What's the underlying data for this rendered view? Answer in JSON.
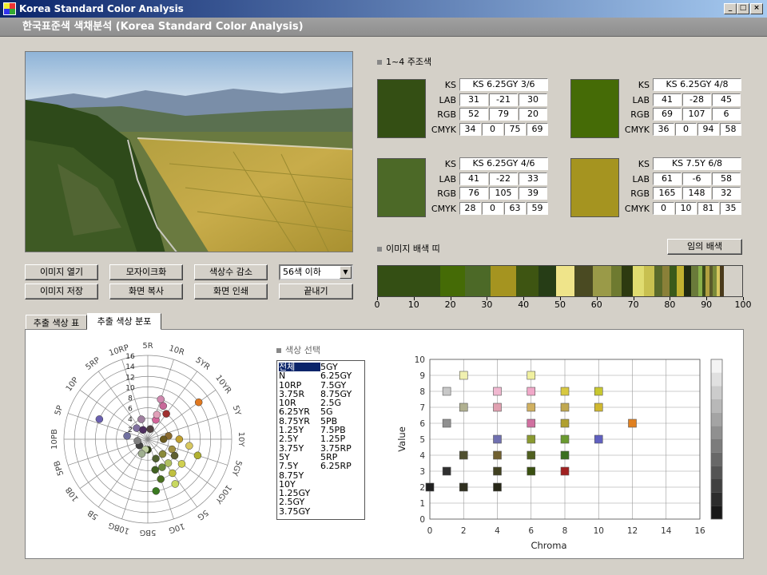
{
  "window": {
    "title": "Korea Standard Color Analysis",
    "min": "_",
    "max": "□",
    "close": "×"
  },
  "banner": "한국표준색 색채분석 (Korea Standard Color Analysis)",
  "buttons": {
    "open": "이미지 열기",
    "mosaic": "모자이크화",
    "reduce": "색상수 감소",
    "save": "이미지 저장",
    "copy": "화면 복사",
    "print": "화면 인쇄",
    "exit": "끝내기",
    "random": "임의 배색"
  },
  "select": {
    "value": "56색 이하",
    "arrow": "▼"
  },
  "main_colors": {
    "heading": "1~4 주조색",
    "labels": [
      "KS",
      "LAB",
      "RGB",
      "CMYK"
    ],
    "items": [
      {
        "ks": "KS 6.25GY 3/6",
        "lab": [
          "31",
          "-21",
          "30"
        ],
        "rgb": [
          "52",
          "79",
          "20"
        ],
        "cmyk": [
          "34",
          "0",
          "75",
          "69"
        ],
        "color": "#344f14"
      },
      {
        "ks": "KS 6.25GY 4/8",
        "lab": [
          "41",
          "-28",
          "45"
        ],
        "rgb": [
          "69",
          "107",
          "6"
        ],
        "cmyk": [
          "36",
          "0",
          "94",
          "58"
        ],
        "color": "#456b06"
      },
      {
        "ks": "KS 6.25GY 4/6",
        "lab": [
          "41",
          "-22",
          "33"
        ],
        "rgb": [
          "76",
          "105",
          "39"
        ],
        "cmyk": [
          "28",
          "0",
          "63",
          "59"
        ],
        "color": "#4c6927"
      },
      {
        "ks": "KS 7.5Y 6/8",
        "lab": [
          "61",
          "-6",
          "58"
        ],
        "rgb": [
          "165",
          "148",
          "32"
        ],
        "cmyk": [
          "0",
          "10",
          "81",
          "35"
        ],
        "color": "#a59420"
      }
    ]
  },
  "palette": {
    "heading": "이미지 배색 띠",
    "ticks": [
      "0",
      "10",
      "20",
      "30",
      "40",
      "50",
      "60",
      "70",
      "80",
      "90",
      "100"
    ],
    "segments": [
      {
        "w": 17,
        "c": "#344f14"
      },
      {
        "w": 7,
        "c": "#456b06"
      },
      {
        "w": 7,
        "c": "#4c6927"
      },
      {
        "w": 7,
        "c": "#a59420"
      },
      {
        "w": 6,
        "c": "#3e5512"
      },
      {
        "w": 5,
        "c": "#263d16"
      },
      {
        "w": 5,
        "c": "#efe48a"
      },
      {
        "w": 5,
        "c": "#4a4a22"
      },
      {
        "w": 5,
        "c": "#9a9a48"
      },
      {
        "w": 3,
        "c": "#6e7a30"
      },
      {
        "w": 3,
        "c": "#2d3a10"
      },
      {
        "w": 3,
        "c": "#e0dc70"
      },
      {
        "w": 3,
        "c": "#c8c050"
      },
      {
        "w": 2,
        "c": "#5a6a2a"
      },
      {
        "w": 2,
        "c": "#8a8038"
      },
      {
        "w": 2,
        "c": "#3a5a1a"
      },
      {
        "w": 2,
        "c": "#c0b030"
      },
      {
        "w": 2,
        "c": "#202a10"
      },
      {
        "w": 2,
        "c": "#6a7a3a"
      },
      {
        "w": 1,
        "c": "#8ab04a"
      },
      {
        "w": 1,
        "c": "#3a4a1a"
      },
      {
        "w": 1,
        "c": "#b0a040"
      },
      {
        "w": 1,
        "c": "#5a5a2a"
      },
      {
        "w": 1,
        "c": "#7a8a3a"
      },
      {
        "w": 1,
        "c": "#d8c860"
      },
      {
        "w": 1,
        "c": "#4a3a1a"
      }
    ]
  },
  "tabs": [
    "추출 색상 표",
    "추출 색상 분포"
  ],
  "color_select": {
    "heading": "색상 선택",
    "col1": [
      "전체",
      "N",
      "10RP",
      "3.75R",
      "10R",
      "6.25YR",
      "8.75YR",
      "1.25Y",
      "2.5Y",
      "3.75Y",
      "5Y",
      "7.5Y",
      "8.75Y",
      "10Y",
      "1.25GY",
      "2.5GY",
      "3.75GY"
    ],
    "col2": [
      "5GY",
      "6.25GY",
      "7.5GY",
      "8.75GY",
      "2.5G",
      "5G",
      "5PB",
      "7.5PB",
      "1.25P",
      "3.75RP",
      "5RP",
      "6.25RP"
    ]
  },
  "polar": {
    "hue_labels": [
      "5R",
      "10R",
      "5YR",
      "10YR",
      "5Y",
      "10Y",
      "5GY",
      "10GY",
      "5G",
      "10G",
      "5BG",
      "10BG",
      "5B",
      "10B",
      "5PB",
      "10PB",
      "5P",
      "10P",
      "5RP",
      "10RP"
    ],
    "ring_labels": [
      "2",
      "4",
      "6",
      "8",
      "10",
      "12",
      "14",
      "16"
    ],
    "points": [
      {
        "hue": 5,
        "chroma": 4,
        "color": "#d4649a"
      },
      {
        "hue": 4,
        "chroma": 8,
        "color": "#d08ab0"
      },
      {
        "hue": 5.5,
        "chroma": 7,
        "color": "#c86a9a"
      },
      {
        "hue": 3,
        "chroma": 2,
        "color": "#504040"
      },
      {
        "hue": 4.5,
        "chroma": 5,
        "color": "#e0a0b8"
      },
      {
        "hue": 8,
        "chroma": 6,
        "color": "#a03030"
      },
      {
        "hue": 12,
        "chroma": 12,
        "color": "#e07820"
      },
      {
        "hue": 20,
        "chroma": 6,
        "color": "#c0a030"
      },
      {
        "hue": 22,
        "chroma": 8,
        "color": "#d8c860"
      },
      {
        "hue": 24,
        "chroma": 10,
        "color": "#b0b030"
      },
      {
        "hue": 18,
        "chroma": 4,
        "color": "#8a6a30"
      },
      {
        "hue": 20,
        "chroma": 3,
        "color": "#6a5a20"
      },
      {
        "hue": 25,
        "chroma": 5,
        "color": "#a09040"
      },
      {
        "hue": 27,
        "chroma": 6,
        "color": "#606030"
      },
      {
        "hue": 28,
        "chroma": 8,
        "color": "#d0d050"
      },
      {
        "hue": 30,
        "chroma": 4,
        "color": "#8a8a3a"
      },
      {
        "hue": 31,
        "chroma": 6,
        "color": "#b0c060"
      },
      {
        "hue": 32,
        "chroma": 8,
        "color": "#c0c040"
      },
      {
        "hue": 33,
        "chroma": 10,
        "color": "#c8d860"
      },
      {
        "hue": 34,
        "chroma": 6,
        "color": "#6a8a3a"
      },
      {
        "hue": 35,
        "chroma": 4,
        "color": "#506030"
      },
      {
        "hue": 36,
        "chroma": 8,
        "color": "#4a7020"
      },
      {
        "hue": 37,
        "chroma": 6,
        "color": "#406020"
      },
      {
        "hue": 38,
        "chroma": 10,
        "color": "#3a7a20"
      },
      {
        "hue": 40,
        "chroma": 2,
        "color": "#2a3a10"
      },
      {
        "hue": 43,
        "chroma": 2,
        "color": "#c0d0a0"
      },
      {
        "hue": 45,
        "chroma": 3,
        "color": "#a0b090"
      },
      {
        "hue": 52,
        "chroma": 2,
        "color": "#404040"
      },
      {
        "hue": 58,
        "chroma": 2,
        "color": "#808080"
      },
      {
        "hue": 62,
        "chroma": 4,
        "color": "#7070a0"
      },
      {
        "hue": 65,
        "chroma": 10,
        "color": "#6a60b0"
      },
      {
        "hue": 70,
        "chroma": 3,
        "color": "#8070a0"
      },
      {
        "hue": 74,
        "chroma": 2,
        "color": "#503060"
      },
      {
        "hue": 76,
        "chroma": 4,
        "color": "#a080a0"
      }
    ]
  },
  "chart_data": {
    "type": "scatter",
    "xlabel": "Chroma",
    "ylabel": "Value",
    "xlim": [
      0,
      16
    ],
    "ylim": [
      0,
      10
    ],
    "xticks": [
      "0",
      "2",
      "4",
      "6",
      "8",
      "10",
      "12",
      "14",
      "16"
    ],
    "yticks": [
      "0",
      "1",
      "2",
      "3",
      "4",
      "5",
      "6",
      "7",
      "8",
      "9",
      "10"
    ],
    "points": [
      {
        "x": 2,
        "y": 9,
        "color": "#f0f0b0"
      },
      {
        "x": 6,
        "y": 9,
        "color": "#f0f0a0"
      },
      {
        "x": 1,
        "y": 8,
        "color": "#c8c8c8"
      },
      {
        "x": 4,
        "y": 8,
        "color": "#f0b8d0"
      },
      {
        "x": 6,
        "y": 8,
        "color": "#f0a8c8"
      },
      {
        "x": 8,
        "y": 8,
        "color": "#d8c840"
      },
      {
        "x": 10,
        "y": 8,
        "color": "#c8c830"
      },
      {
        "x": 2,
        "y": 7,
        "color": "#b0b090"
      },
      {
        "x": 4,
        "y": 7,
        "color": "#e0a0b0"
      },
      {
        "x": 6,
        "y": 7,
        "color": "#d0b060"
      },
      {
        "x": 8,
        "y": 7,
        "color": "#c0a850"
      },
      {
        "x": 10,
        "y": 7,
        "color": "#d0b830"
      },
      {
        "x": 1,
        "y": 6,
        "color": "#909090"
      },
      {
        "x": 6,
        "y": 6,
        "color": "#d070a0"
      },
      {
        "x": 8,
        "y": 6,
        "color": "#b0a030"
      },
      {
        "x": 12,
        "y": 6,
        "color": "#e08020"
      },
      {
        "x": 4,
        "y": 5,
        "color": "#7070b0"
      },
      {
        "x": 6,
        "y": 5,
        "color": "#8a9a30"
      },
      {
        "x": 8,
        "y": 5,
        "color": "#6a9a30"
      },
      {
        "x": 10,
        "y": 5,
        "color": "#6060c0"
      },
      {
        "x": 2,
        "y": 4,
        "color": "#505030"
      },
      {
        "x": 4,
        "y": 4,
        "color": "#706030"
      },
      {
        "x": 6,
        "y": 4,
        "color": "#506020"
      },
      {
        "x": 8,
        "y": 4,
        "color": "#3a7020"
      },
      {
        "x": 1,
        "y": 3,
        "color": "#303030"
      },
      {
        "x": 4,
        "y": 3,
        "color": "#404020"
      },
      {
        "x": 6,
        "y": 3,
        "color": "#3a5010"
      },
      {
        "x": 8,
        "y": 3,
        "color": "#a02020"
      },
      {
        "x": 0,
        "y": 2,
        "color": "#202020"
      },
      {
        "x": 2,
        "y": 2,
        "color": "#303020"
      },
      {
        "x": 4,
        "y": 2,
        "color": "#282818"
      }
    ],
    "gray_scale": [
      "#f4f4f4",
      "#e0e0e0",
      "#cccccc",
      "#b8b8b8",
      "#a4a4a4",
      "#909090",
      "#7c7c7c",
      "#686868",
      "#545454",
      "#404040",
      "#2c2c2c",
      "#181818"
    ]
  }
}
